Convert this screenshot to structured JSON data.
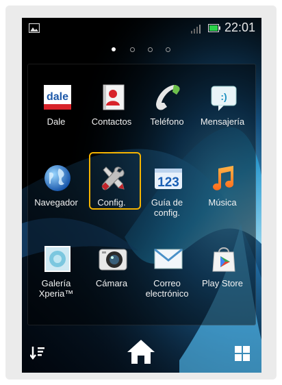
{
  "status": {
    "time": "22:01"
  },
  "apps": [
    {
      "label": "Dale",
      "icon": "dale-icon"
    },
    {
      "label": "Contactos",
      "icon": "contacts-icon"
    },
    {
      "label": "Teléfono",
      "icon": "phone-icon"
    },
    {
      "label": "Mensajería",
      "icon": "messaging-icon"
    },
    {
      "label": "Navegador",
      "icon": "globe-icon"
    },
    {
      "label": "Config.",
      "icon": "settings-tools-icon"
    },
    {
      "label": "Guía de config.",
      "icon": "setup-guide-icon"
    },
    {
      "label": "Música",
      "icon": "music-icon"
    },
    {
      "label": "Galería Xperia™",
      "icon": "gallery-icon"
    },
    {
      "label": "Cámara",
      "icon": "camera-icon"
    },
    {
      "label": "Correo electrónico",
      "icon": "email-icon"
    },
    {
      "label": "Play Store",
      "icon": "play-store-icon"
    }
  ],
  "dale_logo_text": "dale",
  "setup_guide_text": "123",
  "colors": {
    "highlight": "#f6b400",
    "wallpaper_wave": "#2aa7e0"
  }
}
